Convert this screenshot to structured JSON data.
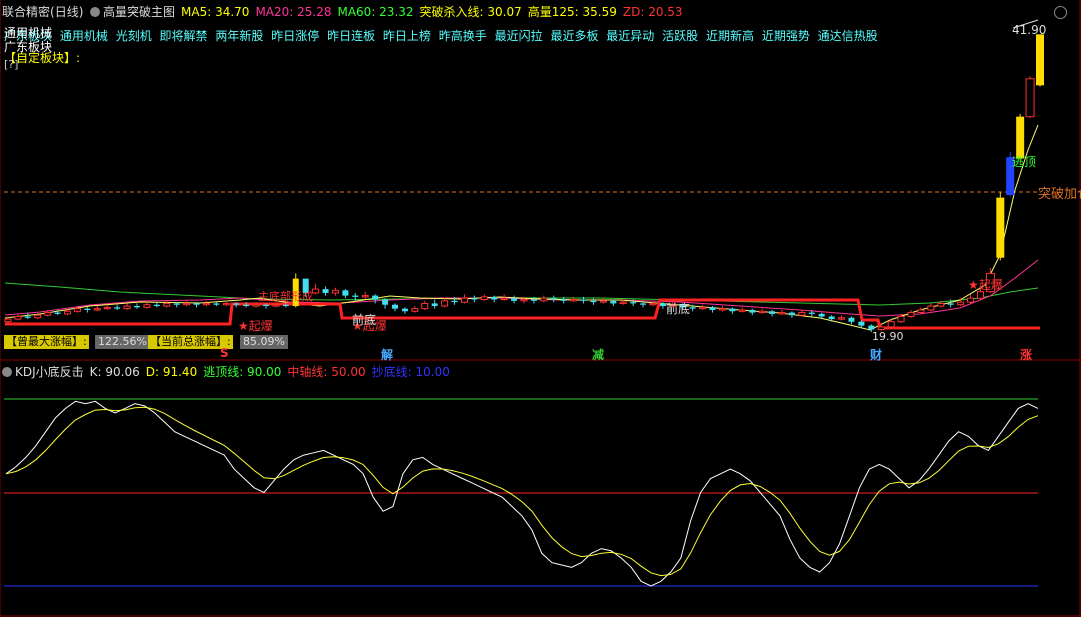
{
  "header": {
    "stock_name": "联合精密",
    "period": "(日线)",
    "indicator_name": "高量突破主图",
    "ma5": "MA5: 34.70",
    "ma20": "MA20: 25.28",
    "ma60": "MA60: 23.32",
    "breakout_line": "突破杀入线: 30.07",
    "high_vol_125": "高量125: 35.59",
    "zd": "ZD: 20.53",
    "colors": {
      "ma5": "#ffff00",
      "ma20": "#ff3399",
      "ma60": "#33ff33",
      "breakout": "#ffff00",
      "highvol": "#ffff00",
      "zd": "#ff3333"
    }
  },
  "sector_overlay": "通用机械",
  "sector_tags": [
    "广东板块",
    "通用机械",
    "光刻机",
    "即将解禁",
    "两年新股",
    "昨日涨停",
    "昨日连板",
    "昨日上榜",
    "昨高换手",
    "最近闪拉",
    "最近多板",
    "最近异动",
    "活跃股",
    "近期新高",
    "近期强势",
    "通达信热股"
  ],
  "sector_row2": "广东板块",
  "custom_block_label": "【自定板块】:",
  "bracket_glyph": "[?]",
  "max_gain_label": "【曾最大涨幅】:",
  "max_gain_value": "122.56%",
  "cur_gain_label": "【当前总涨幅】:",
  "cur_gain_value": "85.09%",
  "bottom_markers": [
    {
      "text": "S",
      "color": "#ff3333"
    },
    {
      "text": "解",
      "color": "#44aaff"
    },
    {
      "text": "减",
      "color": "#33cc33"
    },
    {
      "text": "财",
      "color": "#44aaff"
    },
    {
      "text": "涨",
      "color": "#ff3333"
    }
  ],
  "kdj_header": {
    "name": "KDJ小底反击",
    "k": "K: 90.06",
    "d": "D: 91.40",
    "escape_top": "逃顶线: 90.00",
    "mid_axis": "中轴线: 50.00",
    "bottom_line": "抄底线: 10.00"
  },
  "price_annotations": {
    "high_price": "41.90",
    "breakout_add": "突破加仓",
    "escape": "逃顶",
    "explode_1": "★起爆",
    "explode_2": "★起爆",
    "explode_3": "★起爆",
    "main_bottom": "主底部形成",
    "prev_bottom_1": "前底",
    "prev_bottom_2": "前底",
    "low_price": "19.90"
  },
  "chart_data": {
    "type": "candlestick",
    "price_range": [
      18.5,
      43
    ],
    "high_price_label": 41.9,
    "low_price_label": 19.9,
    "breakout_add_level": 30.07,
    "candles": [
      [
        19.9,
        20.1,
        19.7,
        20.3
      ],
      [
        20.1,
        20.3,
        20,
        20.5
      ],
      [
        20.3,
        20.2,
        20.1,
        20.6
      ],
      [
        20.2,
        20.4,
        20.1,
        20.6
      ],
      [
        20.4,
        20.6,
        20.3,
        20.8
      ],
      [
        20.6,
        20.5,
        20.4,
        20.8
      ],
      [
        20.5,
        20.7,
        20.4,
        20.9
      ],
      [
        20.7,
        20.9,
        20.6,
        21.1
      ],
      [
        20.9,
        20.8,
        20.6,
        21
      ],
      [
        20.8,
        20.9,
        20.7,
        21.1
      ],
      [
        20.9,
        21,
        20.8,
        21.2
      ],
      [
        21,
        20.9,
        20.8,
        21.2
      ],
      [
        20.9,
        21.1,
        20.8,
        21.3
      ],
      [
        21.1,
        21,
        20.9,
        21.3
      ],
      [
        21,
        21.2,
        20.9,
        21.4
      ],
      [
        21.2,
        21.1,
        21,
        21.4
      ],
      [
        21.1,
        21.3,
        21,
        21.5
      ],
      [
        21.3,
        21.2,
        21,
        21.4
      ],
      [
        21.2,
        21.3,
        21.1,
        21.5
      ],
      [
        21.3,
        21.2,
        21,
        21.4
      ],
      [
        21.2,
        21.3,
        21.1,
        21.5
      ],
      [
        21.3,
        21.2,
        21.1,
        21.4
      ],
      [
        21.2,
        21.3,
        21.1,
        21.5
      ],
      [
        21.3,
        21.2,
        21,
        21.4
      ],
      [
        21.2,
        21.1,
        21,
        21.4
      ],
      [
        21.1,
        21.2,
        21,
        21.4
      ],
      [
        21.2,
        21.1,
        20.9,
        21.3
      ],
      [
        21.1,
        21.2,
        21,
        21.3
      ],
      [
        21.2,
        21.1,
        21,
        21.3
      ],
      [
        21.1,
        23.2,
        21,
        23.6
      ],
      [
        23.2,
        22.1,
        21.8,
        23.1
      ],
      [
        22.1,
        22.4,
        22,
        22.8
      ],
      [
        22.4,
        22.1,
        21.9,
        22.6
      ],
      [
        22.1,
        22.3,
        21.9,
        22.5
      ],
      [
        22.3,
        21.9,
        21.7,
        22.4
      ],
      [
        21.9,
        21.8,
        21.5,
        22.1
      ],
      [
        21.8,
        21.9,
        21.6,
        22.2
      ],
      [
        21.9,
        21.6,
        21.3,
        22
      ],
      [
        21.6,
        21.2,
        20.9,
        21.7
      ],
      [
        21.2,
        20.9,
        20.7,
        21.3
      ],
      [
        20.9,
        20.7,
        20.5,
        21
      ],
      [
        20.7,
        20.9,
        20.6,
        21.1
      ],
      [
        20.9,
        21.3,
        20.8,
        21.5
      ],
      [
        21.3,
        21.1,
        20.9,
        21.6
      ],
      [
        21.1,
        21.5,
        21,
        21.7
      ],
      [
        21.5,
        21.4,
        21.2,
        21.8
      ],
      [
        21.4,
        21.7,
        21.3,
        22
      ],
      [
        21.7,
        21.6,
        21.4,
        21.9
      ],
      [
        21.6,
        21.8,
        21.5,
        22
      ],
      [
        21.8,
        21.6,
        21.4,
        21.9
      ],
      [
        21.6,
        21.7,
        21.5,
        22
      ],
      [
        21.7,
        21.5,
        21.3,
        21.9
      ],
      [
        21.5,
        21.6,
        21.3,
        21.8
      ],
      [
        21.6,
        21.5,
        21.3,
        21.8
      ],
      [
        21.5,
        21.7,
        21.4,
        21.9
      ],
      [
        21.7,
        21.6,
        21.4,
        21.9
      ],
      [
        21.6,
        21.5,
        21.3,
        21.8
      ],
      [
        21.5,
        21.6,
        21.4,
        21.8
      ],
      [
        21.6,
        21.5,
        21.3,
        21.8
      ],
      [
        21.5,
        21.4,
        21.2,
        21.7
      ],
      [
        21.4,
        21.5,
        21.3,
        21.7
      ],
      [
        21.5,
        21.3,
        21.1,
        21.6
      ],
      [
        21.3,
        21.4,
        21.2,
        21.6
      ],
      [
        21.4,
        21.3,
        21.1,
        21.6
      ],
      [
        21.3,
        21.2,
        21,
        21.5
      ],
      [
        21.2,
        21.3,
        21.1,
        21.5
      ],
      [
        21.3,
        21.1,
        20.9,
        21.4
      ],
      [
        21.1,
        21.2,
        21,
        21.4
      ],
      [
        21.2,
        21,
        20.8,
        21.3
      ],
      [
        21,
        20.9,
        20.7,
        21.2
      ],
      [
        20.9,
        21,
        20.8,
        21.2
      ],
      [
        21,
        20.8,
        20.6,
        21.1
      ],
      [
        20.8,
        20.9,
        20.7,
        21.1
      ],
      [
        20.9,
        20.7,
        20.5,
        21
      ],
      [
        20.7,
        20.8,
        20.6,
        21
      ],
      [
        20.8,
        20.6,
        20.4,
        20.9
      ],
      [
        20.6,
        20.7,
        20.5,
        20.9
      ],
      [
        20.7,
        20.5,
        20.3,
        20.8
      ],
      [
        20.5,
        20.6,
        20.4,
        20.8
      ],
      [
        20.6,
        20.4,
        20.2,
        20.7
      ],
      [
        20.4,
        20.6,
        20.3,
        20.8
      ],
      [
        20.6,
        20.5,
        20.3,
        20.8
      ],
      [
        20.5,
        20.3,
        20.1,
        20.6
      ],
      [
        20.3,
        20.1,
        19.9,
        20.4
      ],
      [
        20.1,
        20.2,
        20,
        20.4
      ],
      [
        20.2,
        19.9,
        19.7,
        20.3
      ],
      [
        19.9,
        19.6,
        19.4,
        20
      ],
      [
        19.6,
        19.3,
        19.1,
        19.7
      ],
      [
        19.3,
        19.5,
        19.2,
        19.8
      ],
      [
        19.5,
        19.9,
        19.3,
        20.1
      ],
      [
        19.9,
        20.3,
        19.8,
        20.5
      ],
      [
        20.3,
        20.6,
        20.2,
        20.8
      ],
      [
        20.6,
        20.8,
        20.5,
        21
      ],
      [
        20.8,
        21.1,
        20.7,
        21.3
      ],
      [
        21.1,
        21.3,
        21,
        21.5
      ],
      [
        21.3,
        21.2,
        21,
        21.6
      ],
      [
        21.2,
        21.4,
        21.1,
        21.7
      ],
      [
        21.4,
        21.7,
        21.3,
        22
      ],
      [
        21.7,
        22.2,
        21.6,
        22.5
      ],
      [
        22.2,
        23.6,
        22.1,
        24
      ],
      [
        24.8,
        29.4,
        24.6,
        29.8
      ],
      [
        29.6,
        32.5,
        29.5,
        32.9
      ],
      [
        32.4,
        35.6,
        32.3,
        35.8
      ],
      [
        35.6,
        38.5,
        35.5,
        38.7
      ],
      [
        38,
        41.9,
        37.9,
        41.9
      ]
    ],
    "k_values": [
      58,
      61,
      65,
      70,
      76,
      82,
      86,
      89,
      88,
      89,
      86,
      84,
      86,
      88,
      87,
      84,
      80,
      76,
      74,
      72,
      70,
      68,
      66,
      60,
      56,
      52,
      50,
      55,
      60,
      64,
      66,
      67,
      68,
      66,
      64,
      62,
      58,
      48,
      42,
      44,
      58,
      64,
      65,
      62,
      60,
      58,
      56,
      54,
      52,
      50,
      48,
      44,
      40,
      34,
      24,
      20,
      19,
      18,
      20,
      24,
      26,
      25,
      22,
      18,
      12,
      10,
      12,
      16,
      22,
      38,
      50,
      56,
      58,
      60,
      58,
      55,
      50,
      45,
      40,
      30,
      22,
      18,
      16,
      20,
      28,
      40,
      52,
      60,
      62,
      60,
      56,
      52,
      55,
      60,
      66,
      72,
      76,
      74,
      70,
      68,
      74,
      80,
      86,
      88,
      86
    ]
  }
}
